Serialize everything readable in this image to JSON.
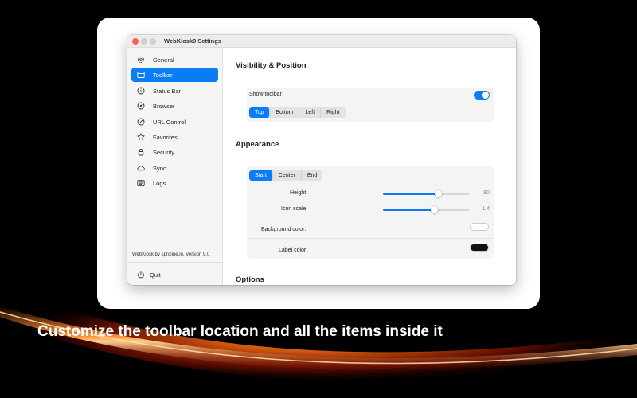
{
  "window": {
    "title": "WebKiosk9 Settings"
  },
  "sidebar": {
    "items": [
      {
        "label": "General",
        "icon": "gear-icon"
      },
      {
        "label": "Toolbar",
        "icon": "window-icon"
      },
      {
        "label": "Status Bar",
        "icon": "info-circle-icon"
      },
      {
        "label": "Browser",
        "icon": "compass-icon"
      },
      {
        "label": "URL Control",
        "icon": "blocked-circle-icon"
      },
      {
        "label": "Favorites",
        "icon": "star-icon"
      },
      {
        "label": "Security",
        "icon": "lock-icon"
      },
      {
        "label": "Sync",
        "icon": "cloud-icon"
      },
      {
        "label": "Logs",
        "icon": "list-icon"
      }
    ],
    "selected": "Toolbar",
    "version_text": "WebKiosk by sproline.io. Version 9.0",
    "quit_label": "Quit"
  },
  "visibility": {
    "title": "Visibility & Position",
    "show_toolbar_label": "Show toolbar",
    "show_toolbar_on": true,
    "position_options": [
      "Top",
      "Bottom",
      "Left",
      "Right"
    ],
    "position_selected": "Top"
  },
  "appearance": {
    "title": "Appearance",
    "align_options": [
      "Start",
      "Center",
      "End"
    ],
    "align_selected": "Start",
    "height_label": "Height:",
    "height_value": "80",
    "height_fraction": 0.64,
    "icon_scale_label": "Icon scale:",
    "icon_scale_value": "1.4",
    "icon_scale_fraction": 0.6,
    "background_color_label": "Background color:",
    "background_color": "#ffffff",
    "label_color_label": "Label color:",
    "label_color": "#111111"
  },
  "options": {
    "title": "Options"
  },
  "caption": "Customize the toolbar location and all the items inside it",
  "colors": {
    "accent": "#0a7cf5"
  }
}
